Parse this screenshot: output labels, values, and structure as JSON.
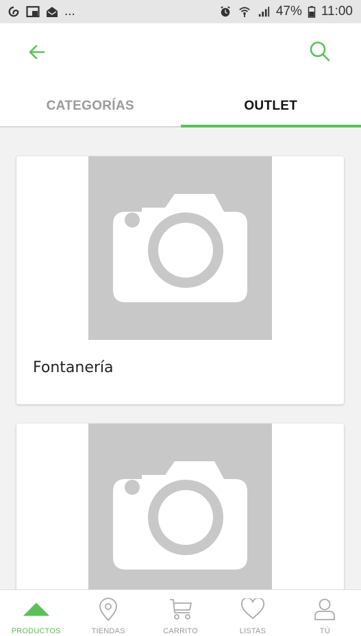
{
  "status_bar": {
    "ellipsis": "...",
    "battery": "47%",
    "time": "11:00",
    "icons": [
      "swirl-icon",
      "window-icon",
      "mail-icon",
      "alarm-icon",
      "wifi-icon",
      "signal-icon",
      "battery-icon"
    ]
  },
  "header": {
    "back_icon": "arrow-left-icon",
    "search_icon": "search-icon",
    "accent_color": "#5cbf5a"
  },
  "tabs": [
    {
      "label": "CATEGORÍAS",
      "active": false
    },
    {
      "label": "OUTLET",
      "active": true
    }
  ],
  "cards": [
    {
      "title": "Fontanería",
      "image_icon": "camera-placeholder-icon"
    },
    {
      "title": "",
      "image_icon": "camera-placeholder-icon"
    }
  ],
  "bottom_nav": {
    "items": [
      {
        "label": "PRODUCTOS",
        "icon": "triangle-icon",
        "active": true
      },
      {
        "label": "TIENDAS",
        "icon": "location-pin-icon",
        "active": false
      },
      {
        "label": "CARRITO",
        "icon": "cart-icon",
        "active": false
      },
      {
        "label": "LISTAS",
        "icon": "heart-icon",
        "active": false
      },
      {
        "label": "TÚ",
        "icon": "user-icon",
        "active": false
      }
    ]
  }
}
